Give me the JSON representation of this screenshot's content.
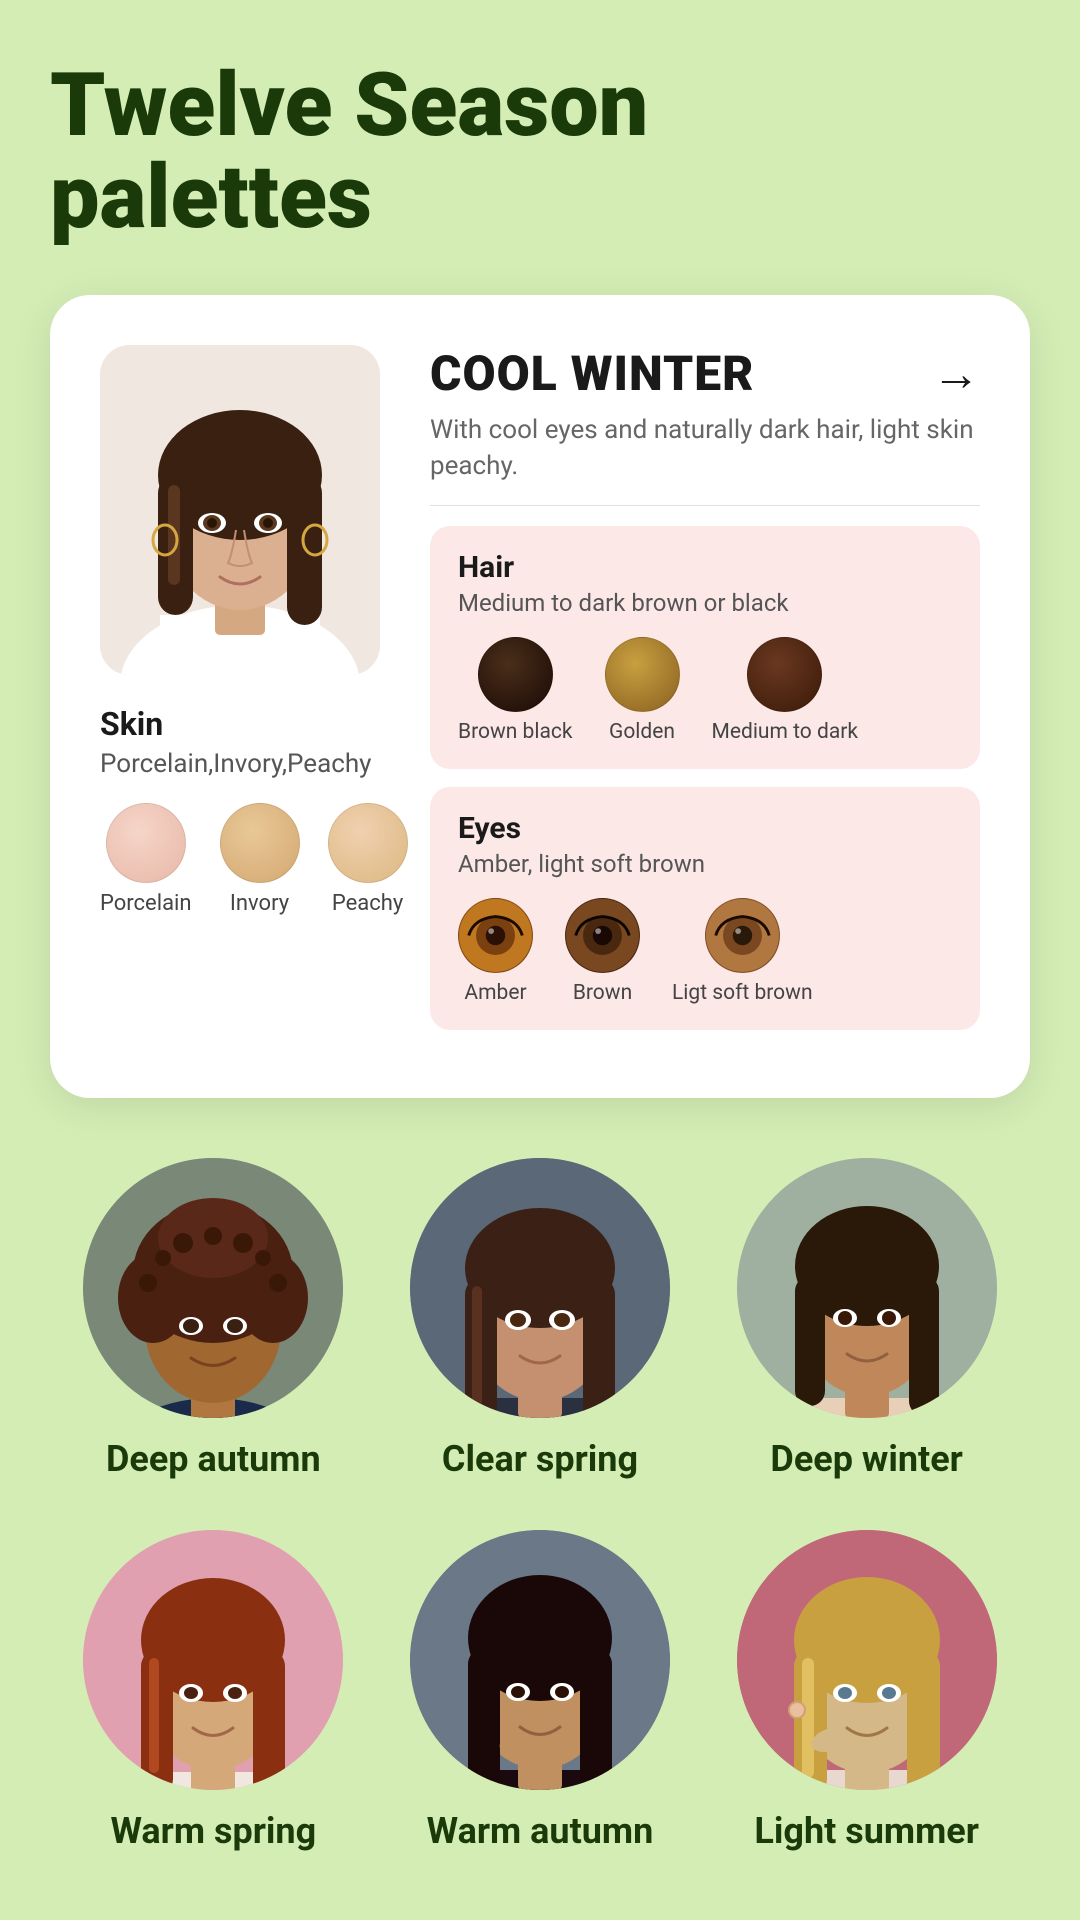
{
  "page": {
    "title_line1": "Twelve Season",
    "title_line2": "palettes",
    "background_color": "#d4edb5"
  },
  "main_card": {
    "season_title": "COOL WINTER",
    "season_description": "With cool eyes and naturally dark hair, light skin peachy.",
    "arrow_label": "→",
    "skin": {
      "section_title": "Skin",
      "section_subtitle": "Porcelain,Invory,Peachy",
      "swatches": [
        {
          "label": "Porcelain",
          "color_class": "swatch-porcelain"
        },
        {
          "label": "Invory",
          "color_class": "swatch-ivory"
        },
        {
          "label": "Peachy",
          "color_class": "swatch-peachy"
        }
      ]
    },
    "hair": {
      "section_title": "Hair",
      "section_subtitle": "Medium to dark brown or black",
      "swatches": [
        {
          "label": "Brown black",
          "color_class": "hair-brownblack"
        },
        {
          "label": "Golden",
          "color_class": "hair-golden"
        },
        {
          "label": "Medium to dark",
          "color_class": "hair-mediumdark"
        }
      ]
    },
    "eyes": {
      "section_title": "Eyes",
      "section_subtitle": "Amber, light soft brown",
      "swatches": [
        {
          "label": "Amber",
          "color_class": "eye-amber-color"
        },
        {
          "label": "Brown",
          "color_class": "eye-brown-color"
        },
        {
          "label": "Ligt soft brown",
          "color_class": "eye-lightbrown-color"
        }
      ]
    }
  },
  "person_rows": [
    {
      "people": [
        {
          "name": "Deep autumn",
          "bg_class": "face-bg-gray"
        },
        {
          "name": "Clear spring",
          "bg_class": "face-bg-dark"
        },
        {
          "name": "Deep winter",
          "bg_class": "face-bg-light"
        }
      ]
    },
    {
      "people": [
        {
          "name": "Warm spring",
          "bg_class": "face-bg-pink"
        },
        {
          "name": "Warm autumn",
          "bg_class": "face-bg-mid"
        },
        {
          "name": "Light summer",
          "bg_class": "face-bg-rose"
        }
      ]
    }
  ]
}
